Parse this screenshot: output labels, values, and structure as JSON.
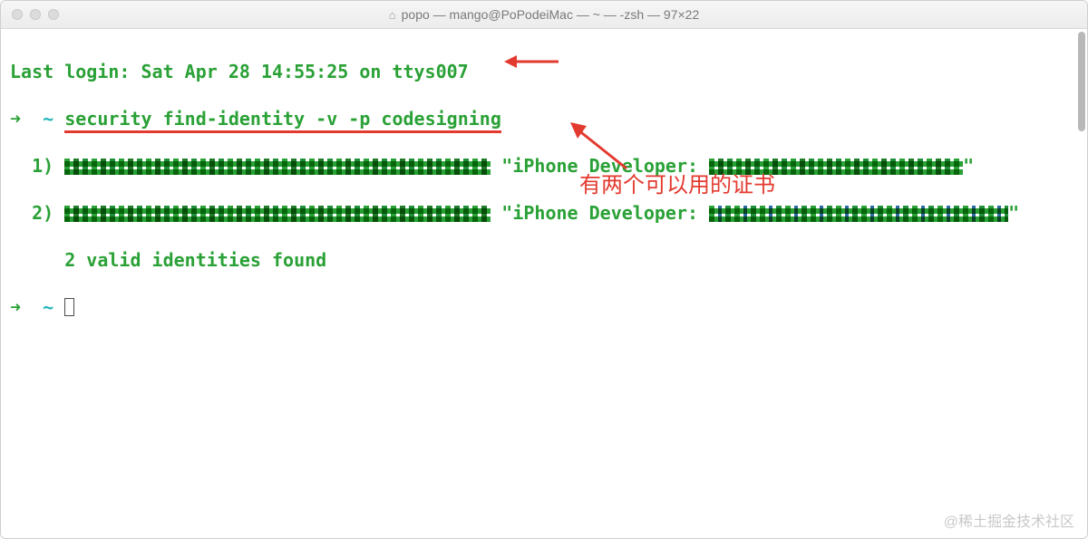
{
  "window": {
    "title": "popo — mango@PoPodeiMac — ~ — -zsh — 97×22"
  },
  "terminal": {
    "last_login": "Last login: Sat Apr 28 14:55:25 on ttys007",
    "prompt_arrow": "➜",
    "prompt_tilde": "~",
    "command": "security find-identity -v -p codesigning",
    "rows": [
      {
        "index": "1)",
        "label": "\"iPhone Developer:",
        "tail": "\""
      },
      {
        "index": "2)",
        "label": "\"iPhone Developer:",
        "tail": "\""
      }
    ],
    "summary": "2 valid identities found"
  },
  "annotation": {
    "text": "有两个可以用的证书"
  },
  "watermark": "@稀土掘金技术社区"
}
